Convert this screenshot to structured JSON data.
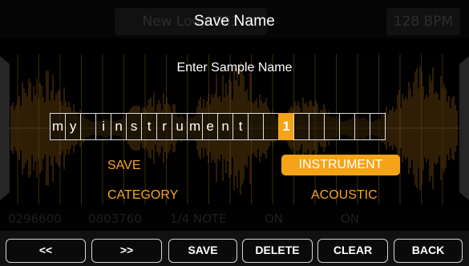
{
  "background": {
    "loop_name": "New Loop 001",
    "bpm": "128 BPM",
    "info": [
      "0296600",
      "0803760",
      "1/4 NOTE",
      "ON",
      "ON"
    ]
  },
  "dialog": {
    "title": "Save Name",
    "prompt": "Enter Sample Name",
    "characters": [
      "m",
      "y",
      "",
      "i",
      "n",
      "s",
      "t",
      "r",
      "u",
      "m",
      "e",
      "n",
      "t",
      "",
      "",
      "1",
      "",
      "",
      "",
      "",
      "",
      ""
    ],
    "cursor_index": 15,
    "save_label": "SAVE",
    "category_label": "CATEGORY",
    "instrument_value": "INSTRUMENT",
    "acoustic_value": "ACOUSTIC"
  },
  "buttons": {
    "prev": "<<",
    "next": ">>",
    "save": "SAVE",
    "delete": "DELETE",
    "clear": "CLEAR",
    "back": "BACK"
  },
  "colors": {
    "accent": "#f4a416",
    "waveform": "#5a3a0c",
    "gridline": "#3a2a0a"
  }
}
